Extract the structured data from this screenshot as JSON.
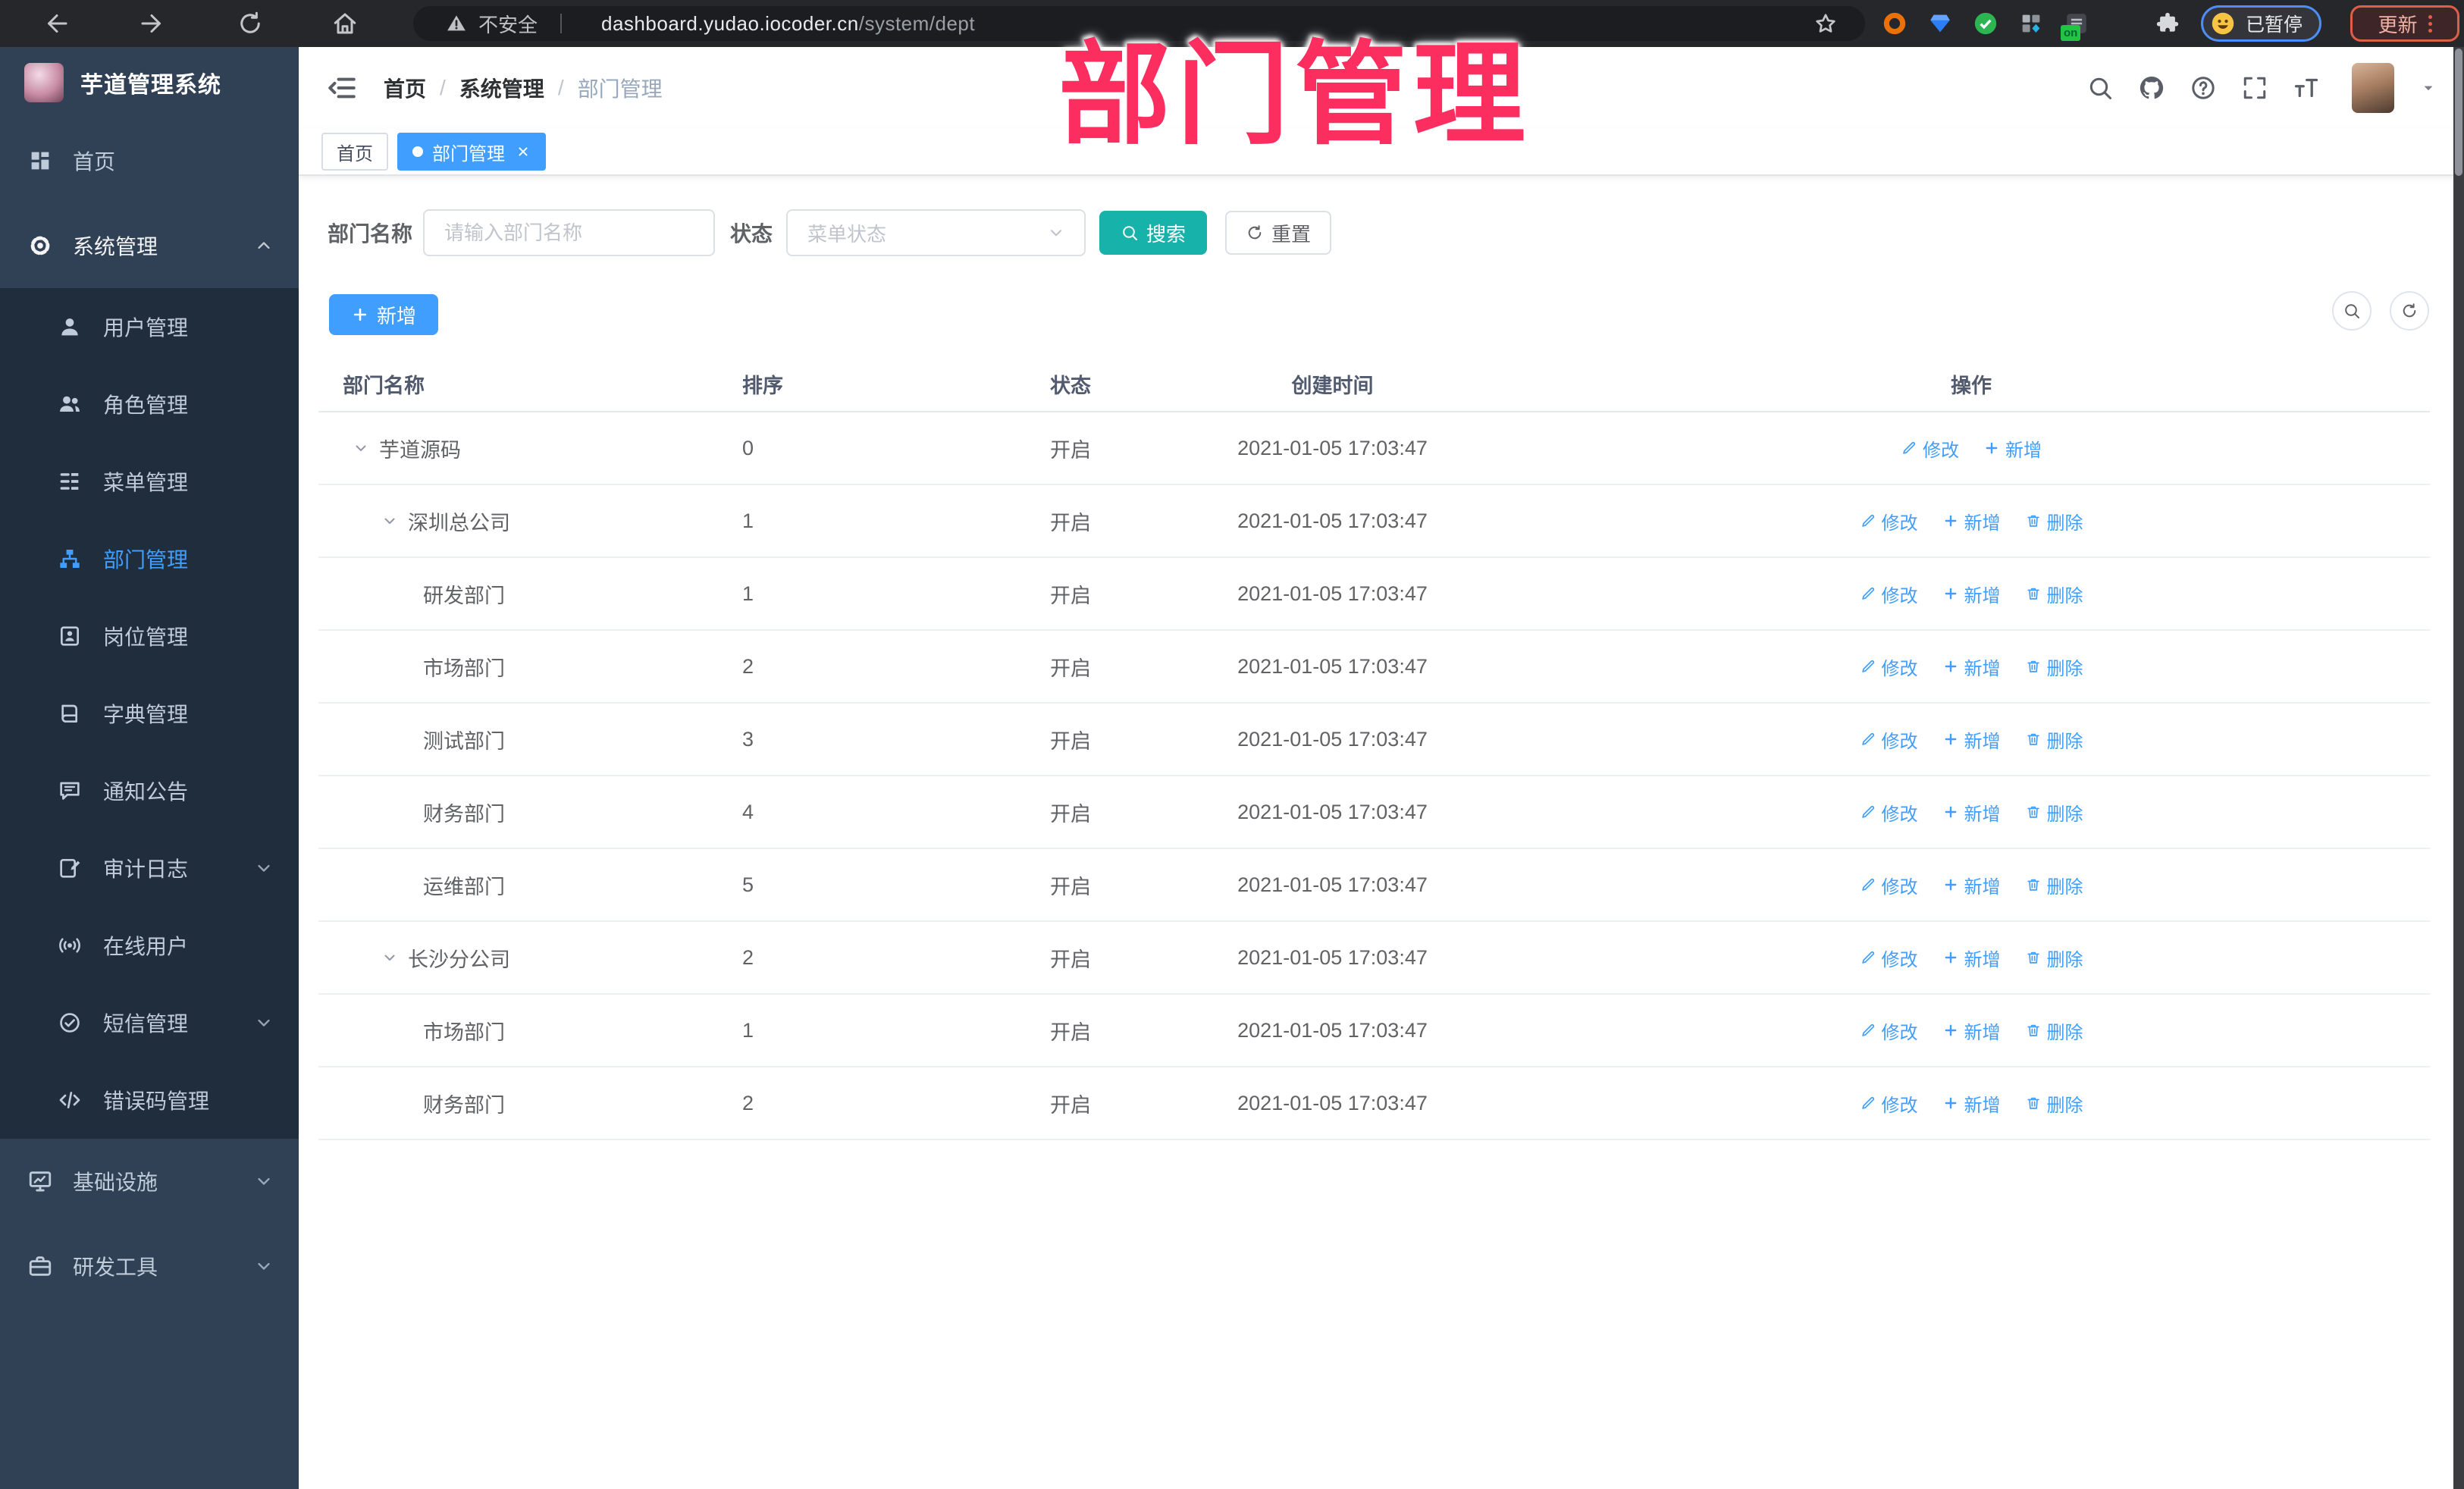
{
  "browser": {
    "security_label": "不安全",
    "url_domain": "dashboard.yudao.iocoder.cn",
    "url_path": "/system/dept",
    "extension_badge": "on",
    "profile_status_label": "已暂停",
    "update_label": "更新"
  },
  "watermark_text": "部门管理",
  "sidebar": {
    "logo_title": "芋道管理系统",
    "menu": [
      {
        "id": "home",
        "label": "首页",
        "icon": "dashboard",
        "type": "top"
      },
      {
        "id": "system",
        "label": "系统管理",
        "icon": "gear",
        "type": "top",
        "arrow": "up",
        "open": true
      },
      {
        "id": "user",
        "label": "用户管理",
        "icon": "user",
        "type": "sub"
      },
      {
        "id": "role",
        "label": "角色管理",
        "icon": "users",
        "type": "sub"
      },
      {
        "id": "menu",
        "label": "菜单管理",
        "icon": "menu-grid",
        "type": "sub"
      },
      {
        "id": "dept",
        "label": "部门管理",
        "icon": "org-tree",
        "type": "sub",
        "active": true
      },
      {
        "id": "post",
        "label": "岗位管理",
        "icon": "badge",
        "type": "sub"
      },
      {
        "id": "dict",
        "label": "字典管理",
        "icon": "book",
        "type": "sub"
      },
      {
        "id": "notice",
        "label": "通知公告",
        "icon": "notice",
        "type": "sub"
      },
      {
        "id": "audit-log",
        "label": "审计日志",
        "icon": "log-edit",
        "type": "sub",
        "arrow": "down"
      },
      {
        "id": "online-user",
        "label": "在线用户",
        "icon": "online",
        "type": "sub"
      },
      {
        "id": "sms",
        "label": "短信管理",
        "icon": "check-circle",
        "type": "sub",
        "arrow": "down"
      },
      {
        "id": "error-code",
        "label": "错误码管理",
        "icon": "code",
        "type": "sub"
      },
      {
        "id": "infra",
        "label": "基础设施",
        "icon": "monitor",
        "type": "top",
        "arrow": "down"
      },
      {
        "id": "dev-tools",
        "label": "研发工具",
        "icon": "briefcase",
        "type": "top",
        "arrow": "down"
      }
    ]
  },
  "header": {
    "breadcrumbs": [
      "首页",
      "系统管理",
      "部门管理"
    ]
  },
  "tags": [
    {
      "label": "首页",
      "active": false,
      "closable": false
    },
    {
      "label": "部门管理",
      "active": true,
      "closable": true
    }
  ],
  "filter": {
    "name_label": "部门名称",
    "name_placeholder": "请输入部门名称",
    "status_label": "状态",
    "status_placeholder": "菜单状态",
    "search_label": "搜索",
    "reset_label": "重置"
  },
  "toolbar": {
    "add_label": "新增"
  },
  "table": {
    "columns": [
      "部门名称",
      "排序",
      "状态",
      "创建时间",
      "操作"
    ],
    "action_labels": {
      "edit": "修改",
      "add": "新增",
      "delete": "删除"
    },
    "rows": [
      {
        "name": "芋道源码",
        "level": 1,
        "expandable": true,
        "sort": "0",
        "status": "开启",
        "created": "2021-01-05 17:03:47",
        "actions": [
          "edit",
          "add"
        ]
      },
      {
        "name": "深圳总公司",
        "level": 2,
        "expandable": true,
        "sort": "1",
        "status": "开启",
        "created": "2021-01-05 17:03:47",
        "actions": [
          "edit",
          "add",
          "delete"
        ]
      },
      {
        "name": "研发部门",
        "level": 3,
        "expandable": false,
        "sort": "1",
        "status": "开启",
        "created": "2021-01-05 17:03:47",
        "actions": [
          "edit",
          "add",
          "delete"
        ]
      },
      {
        "name": "市场部门",
        "level": 3,
        "expandable": false,
        "sort": "2",
        "status": "开启",
        "created": "2021-01-05 17:03:47",
        "actions": [
          "edit",
          "add",
          "delete"
        ]
      },
      {
        "name": "测试部门",
        "level": 3,
        "expandable": false,
        "sort": "3",
        "status": "开启",
        "created": "2021-01-05 17:03:47",
        "actions": [
          "edit",
          "add",
          "delete"
        ]
      },
      {
        "name": "财务部门",
        "level": 3,
        "expandable": false,
        "sort": "4",
        "status": "开启",
        "created": "2021-01-05 17:03:47",
        "actions": [
          "edit",
          "add",
          "delete"
        ]
      },
      {
        "name": "运维部门",
        "level": 3,
        "expandable": false,
        "sort": "5",
        "status": "开启",
        "created": "2021-01-05 17:03:47",
        "actions": [
          "edit",
          "add",
          "delete"
        ]
      },
      {
        "name": "长沙分公司",
        "level": 2,
        "expandable": true,
        "sort": "2",
        "status": "开启",
        "created": "2021-01-05 17:03:47",
        "actions": [
          "edit",
          "add",
          "delete"
        ]
      },
      {
        "name": "市场部门",
        "level": 3,
        "expandable": false,
        "sort": "1",
        "status": "开启",
        "created": "2021-01-05 17:03:47",
        "actions": [
          "edit",
          "add",
          "delete"
        ]
      },
      {
        "name": "财务部门",
        "level": 3,
        "expandable": false,
        "sort": "2",
        "status": "开启",
        "created": "2021-01-05 17:03:47",
        "actions": [
          "edit",
          "add",
          "delete"
        ]
      }
    ]
  },
  "colors": {
    "primary_blue": "#409eff",
    "search_teal": "#17b2aa",
    "watermark_pink": "#fb2e5f",
    "sidebar_bg": "#304156",
    "submenu_bg": "#1f2d3d",
    "sidebar_text": "#bfcbd9"
  }
}
